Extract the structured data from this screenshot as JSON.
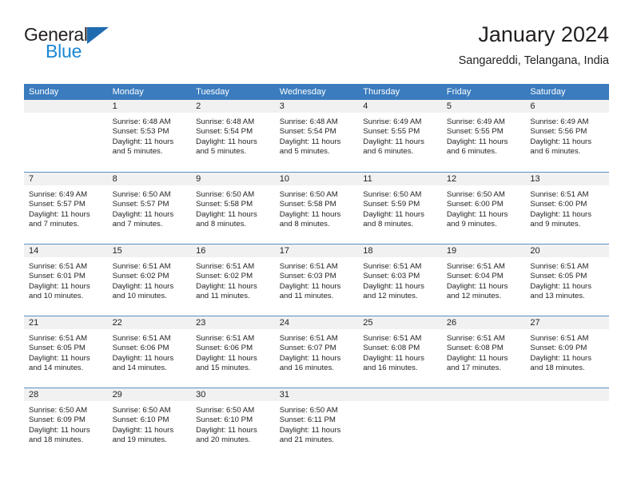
{
  "logo": {
    "word1": "General",
    "word2": "Blue",
    "triangle_color": "#1f6bb0",
    "blue_color": "#1b87d4"
  },
  "header": {
    "title": "January 2024",
    "subtitle": "Sangareddi, Telangana, India"
  },
  "theme": {
    "header_bg": "#3a7cbe",
    "daynum_bg": "#f1f1f1",
    "text": "#231f20"
  },
  "weekdays": [
    "Sunday",
    "Monday",
    "Tuesday",
    "Wednesday",
    "Thursday",
    "Friday",
    "Saturday"
  ],
  "weeks": [
    [
      {
        "day": "",
        "sunrise": "",
        "sunset": "",
        "daylight1": "",
        "daylight2": ""
      },
      {
        "day": "1",
        "sunrise": "Sunrise: 6:48 AM",
        "sunset": "Sunset: 5:53 PM",
        "daylight1": "Daylight: 11 hours",
        "daylight2": "and 5 minutes."
      },
      {
        "day": "2",
        "sunrise": "Sunrise: 6:48 AM",
        "sunset": "Sunset: 5:54 PM",
        "daylight1": "Daylight: 11 hours",
        "daylight2": "and 5 minutes."
      },
      {
        "day": "3",
        "sunrise": "Sunrise: 6:48 AM",
        "sunset": "Sunset: 5:54 PM",
        "daylight1": "Daylight: 11 hours",
        "daylight2": "and 5 minutes."
      },
      {
        "day": "4",
        "sunrise": "Sunrise: 6:49 AM",
        "sunset": "Sunset: 5:55 PM",
        "daylight1": "Daylight: 11 hours",
        "daylight2": "and 6 minutes."
      },
      {
        "day": "5",
        "sunrise": "Sunrise: 6:49 AM",
        "sunset": "Sunset: 5:55 PM",
        "daylight1": "Daylight: 11 hours",
        "daylight2": "and 6 minutes."
      },
      {
        "day": "6",
        "sunrise": "Sunrise: 6:49 AM",
        "sunset": "Sunset: 5:56 PM",
        "daylight1": "Daylight: 11 hours",
        "daylight2": "and 6 minutes."
      }
    ],
    [
      {
        "day": "7",
        "sunrise": "Sunrise: 6:49 AM",
        "sunset": "Sunset: 5:57 PM",
        "daylight1": "Daylight: 11 hours",
        "daylight2": "and 7 minutes."
      },
      {
        "day": "8",
        "sunrise": "Sunrise: 6:50 AM",
        "sunset": "Sunset: 5:57 PM",
        "daylight1": "Daylight: 11 hours",
        "daylight2": "and 7 minutes."
      },
      {
        "day": "9",
        "sunrise": "Sunrise: 6:50 AM",
        "sunset": "Sunset: 5:58 PM",
        "daylight1": "Daylight: 11 hours",
        "daylight2": "and 8 minutes."
      },
      {
        "day": "10",
        "sunrise": "Sunrise: 6:50 AM",
        "sunset": "Sunset: 5:58 PM",
        "daylight1": "Daylight: 11 hours",
        "daylight2": "and 8 minutes."
      },
      {
        "day": "11",
        "sunrise": "Sunrise: 6:50 AM",
        "sunset": "Sunset: 5:59 PM",
        "daylight1": "Daylight: 11 hours",
        "daylight2": "and 8 minutes."
      },
      {
        "day": "12",
        "sunrise": "Sunrise: 6:50 AM",
        "sunset": "Sunset: 6:00 PM",
        "daylight1": "Daylight: 11 hours",
        "daylight2": "and 9 minutes."
      },
      {
        "day": "13",
        "sunrise": "Sunrise: 6:51 AM",
        "sunset": "Sunset: 6:00 PM",
        "daylight1": "Daylight: 11 hours",
        "daylight2": "and 9 minutes."
      }
    ],
    [
      {
        "day": "14",
        "sunrise": "Sunrise: 6:51 AM",
        "sunset": "Sunset: 6:01 PM",
        "daylight1": "Daylight: 11 hours",
        "daylight2": "and 10 minutes."
      },
      {
        "day": "15",
        "sunrise": "Sunrise: 6:51 AM",
        "sunset": "Sunset: 6:02 PM",
        "daylight1": "Daylight: 11 hours",
        "daylight2": "and 10 minutes."
      },
      {
        "day": "16",
        "sunrise": "Sunrise: 6:51 AM",
        "sunset": "Sunset: 6:02 PM",
        "daylight1": "Daylight: 11 hours",
        "daylight2": "and 11 minutes."
      },
      {
        "day": "17",
        "sunrise": "Sunrise: 6:51 AM",
        "sunset": "Sunset: 6:03 PM",
        "daylight1": "Daylight: 11 hours",
        "daylight2": "and 11 minutes."
      },
      {
        "day": "18",
        "sunrise": "Sunrise: 6:51 AM",
        "sunset": "Sunset: 6:03 PM",
        "daylight1": "Daylight: 11 hours",
        "daylight2": "and 12 minutes."
      },
      {
        "day": "19",
        "sunrise": "Sunrise: 6:51 AM",
        "sunset": "Sunset: 6:04 PM",
        "daylight1": "Daylight: 11 hours",
        "daylight2": "and 12 minutes."
      },
      {
        "day": "20",
        "sunrise": "Sunrise: 6:51 AM",
        "sunset": "Sunset: 6:05 PM",
        "daylight1": "Daylight: 11 hours",
        "daylight2": "and 13 minutes."
      }
    ],
    [
      {
        "day": "21",
        "sunrise": "Sunrise: 6:51 AM",
        "sunset": "Sunset: 6:05 PM",
        "daylight1": "Daylight: 11 hours",
        "daylight2": "and 14 minutes."
      },
      {
        "day": "22",
        "sunrise": "Sunrise: 6:51 AM",
        "sunset": "Sunset: 6:06 PM",
        "daylight1": "Daylight: 11 hours",
        "daylight2": "and 14 minutes."
      },
      {
        "day": "23",
        "sunrise": "Sunrise: 6:51 AM",
        "sunset": "Sunset: 6:06 PM",
        "daylight1": "Daylight: 11 hours",
        "daylight2": "and 15 minutes."
      },
      {
        "day": "24",
        "sunrise": "Sunrise: 6:51 AM",
        "sunset": "Sunset: 6:07 PM",
        "daylight1": "Daylight: 11 hours",
        "daylight2": "and 16 minutes."
      },
      {
        "day": "25",
        "sunrise": "Sunrise: 6:51 AM",
        "sunset": "Sunset: 6:08 PM",
        "daylight1": "Daylight: 11 hours",
        "daylight2": "and 16 minutes."
      },
      {
        "day": "26",
        "sunrise": "Sunrise: 6:51 AM",
        "sunset": "Sunset: 6:08 PM",
        "daylight1": "Daylight: 11 hours",
        "daylight2": "and 17 minutes."
      },
      {
        "day": "27",
        "sunrise": "Sunrise: 6:51 AM",
        "sunset": "Sunset: 6:09 PM",
        "daylight1": "Daylight: 11 hours",
        "daylight2": "and 18 minutes."
      }
    ],
    [
      {
        "day": "28",
        "sunrise": "Sunrise: 6:50 AM",
        "sunset": "Sunset: 6:09 PM",
        "daylight1": "Daylight: 11 hours",
        "daylight2": "and 18 minutes."
      },
      {
        "day": "29",
        "sunrise": "Sunrise: 6:50 AM",
        "sunset": "Sunset: 6:10 PM",
        "daylight1": "Daylight: 11 hours",
        "daylight2": "and 19 minutes."
      },
      {
        "day": "30",
        "sunrise": "Sunrise: 6:50 AM",
        "sunset": "Sunset: 6:10 PM",
        "daylight1": "Daylight: 11 hours",
        "daylight2": "and 20 minutes."
      },
      {
        "day": "31",
        "sunrise": "Sunrise: 6:50 AM",
        "sunset": "Sunset: 6:11 PM",
        "daylight1": "Daylight: 11 hours",
        "daylight2": "and 21 minutes."
      },
      {
        "day": "",
        "sunrise": "",
        "sunset": "",
        "daylight1": "",
        "daylight2": ""
      },
      {
        "day": "",
        "sunrise": "",
        "sunset": "",
        "daylight1": "",
        "daylight2": ""
      },
      {
        "day": "",
        "sunrise": "",
        "sunset": "",
        "daylight1": "",
        "daylight2": ""
      }
    ]
  ]
}
